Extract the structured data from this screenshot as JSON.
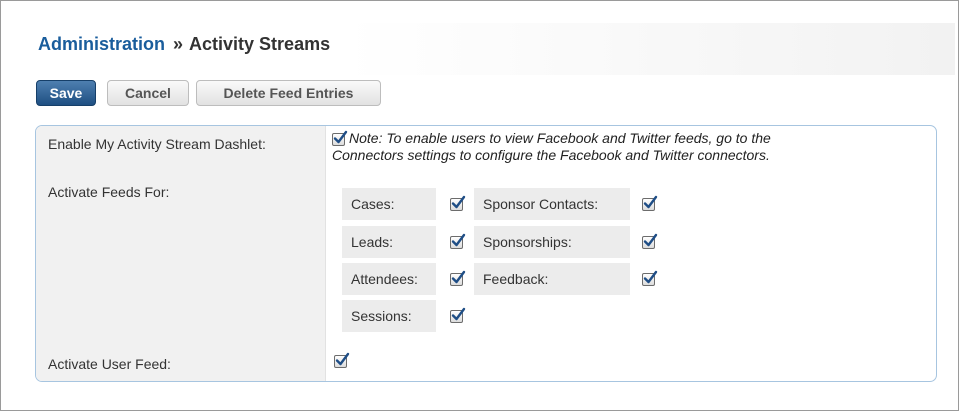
{
  "breadcrumb": {
    "parent": "Administration",
    "separator": "»",
    "current": "Activity Streams"
  },
  "toolbar": {
    "save_label": "Save",
    "cancel_label": "Cancel",
    "delete_label": "Delete Feed Entries"
  },
  "settings": {
    "enable_dashlet": {
      "label": "Enable My Activity Stream Dashlet:",
      "checked": true,
      "note_line1": "Note: To enable users to view Facebook and Twitter feeds, go to the",
      "note_line2": "Connectors settings to configure the Facebook and Twitter connectors."
    },
    "activate_feeds": {
      "label": "Activate Feeds For:",
      "items": [
        {
          "label": "Cases:",
          "checked": true
        },
        {
          "label": "Sponsor Contacts:",
          "checked": true
        },
        {
          "label": "Leads:",
          "checked": true
        },
        {
          "label": "Sponsorships:",
          "checked": true
        },
        {
          "label": "Attendees:",
          "checked": true
        },
        {
          "label": "Feedback:",
          "checked": true
        },
        {
          "label": "Sessions:",
          "checked": true
        }
      ]
    },
    "user_feed": {
      "label": "Activate User Feed:",
      "checked": true
    }
  },
  "colors": {
    "link": "#1a5d9c",
    "primary_button": "#2a5a8c",
    "panel_border": "#a7c5e0",
    "label_bg": "#f1f1f1",
    "check_mark": "#1f4e86"
  }
}
